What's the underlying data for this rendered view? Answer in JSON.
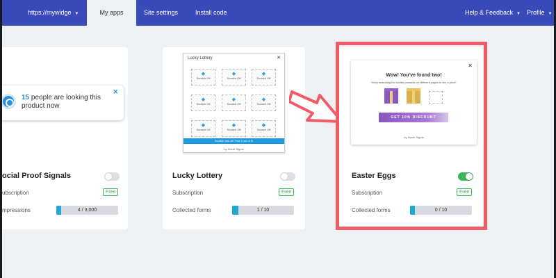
{
  "nav": {
    "site_select": "https://mywidge",
    "my_apps": "My apps",
    "site_settings": "Site settings",
    "install_code": "Install code",
    "help_feedback": "Help & Feedback",
    "profile": "Profile"
  },
  "cards": {
    "social_proof": {
      "title": "ocial Proof Signals",
      "subscription_label": "ubscription",
      "badge": "Free",
      "stat_label": "mpressions",
      "stat_value": "4 / 3,000",
      "progress_fraction": 0.03,
      "enabled": false,
      "preview": {
        "count": "15",
        "message": "people are looking this product now",
        "close": "✕"
      }
    },
    "lucky_lottery": {
      "title": "Lucky Lottery",
      "subscription_label": "Subscription",
      "badge": "Free",
      "stat_label": "Collected forms",
      "stat_value": "1 / 10",
      "progress_fraction": 0.1,
      "enabled": false,
      "preview": {
        "title": "Lucky Lottery",
        "close": "✕",
        "tile_label": "Scratch Off",
        "bar_text": "Scratch this off! Find 3 out of 9!",
        "footer": "by Hover Signal"
      }
    },
    "easter_eggs": {
      "title": "Easter Eggs",
      "subscription_label": "Subscription",
      "badge": "Free",
      "stat_label": "Collected forms",
      "stat_value": "0 / 10",
      "progress_fraction": 0.04,
      "enabled": true,
      "preview": {
        "title": "Wow! You've found two!",
        "subtitle": "Keep searching for hidden presents on different pages to win a prize!",
        "button": "GET 10% DISCOUNT",
        "close": "✕",
        "footer": "by Hover Signal"
      }
    }
  },
  "colors": {
    "nav_bg": "#3a4ab8",
    "accent": "#21a8cf",
    "toggle_on": "#3cb45a",
    "highlight": "#ef5b67",
    "arrow": "#ef5b67"
  }
}
